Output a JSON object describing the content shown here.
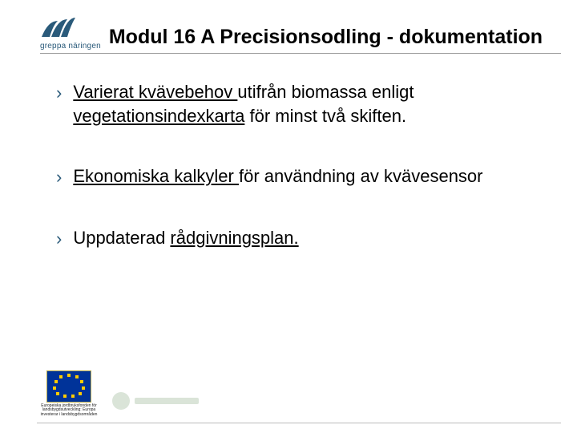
{
  "logo": {
    "text": "greppa näringen"
  },
  "title": "Modul 16 A Precisionsodling - dokumentation",
  "bullets": [
    {
      "marker": "›",
      "parts": [
        {
          "text": "Varierat kvävebehov ",
          "underline": true
        },
        {
          "text": "utifrån biomassa enligt ",
          "underline": false
        },
        {
          "text": "vegetationsindexkarta",
          "underline": true
        },
        {
          "text": " för minst två skiften.",
          "underline": false
        }
      ]
    },
    {
      "marker": "›",
      "parts": [
        {
          "text": "Ekonomiska kalkyler ",
          "underline": true
        },
        {
          "text": "för användning av kvävesensor",
          "underline": false
        }
      ]
    },
    {
      "marker": "›",
      "parts": [
        {
          "text": "Uppdaterad ",
          "underline": false
        },
        {
          "text": "rådgivningsplan.",
          "underline": true
        }
      ]
    }
  ],
  "footer": {
    "eu_caption": "Europeiska jordbruksfonden för landsbygdsutveckling: Europa investerar i landsbygdsområden"
  }
}
